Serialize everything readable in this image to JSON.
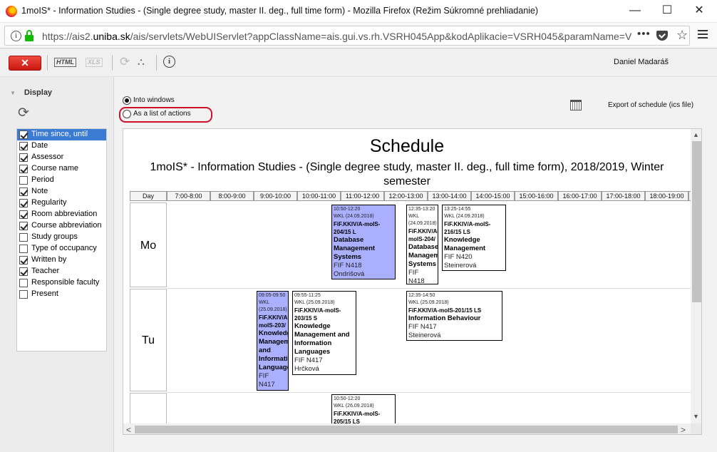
{
  "window": {
    "title": "1moIS* - Information Studies - (Single degree study, master II. deg., full time form) - Mozilla Firefox (Režim Súkromné prehliadanie)",
    "minimize": "—",
    "maximize": "☐",
    "close": "✕"
  },
  "urlbar": {
    "info": "i",
    "url_prefix": "https://ais2.",
    "url_domain": "uniba.sk",
    "url_rest": "/ais/servlets/WebUIServlet?appClassName=ais.gui.vs.rh.VSRH045App&kodAplikacie=VSRH045&paramName=VSRI",
    "more": "•••",
    "star": "☆"
  },
  "toolbar": {
    "close_label": "✕",
    "html_label": "HTML",
    "xls_label": "XLS",
    "refresh": "⟳",
    "tree": "⛬",
    "info": "i",
    "user": "Daniel Madaráš"
  },
  "left_panel": {
    "header": "Display",
    "tri": "▼",
    "refresh": "⟳",
    "items": [
      {
        "label": "Time since, until",
        "checked": true,
        "selected": true
      },
      {
        "label": "Date",
        "checked": true,
        "selected": false
      },
      {
        "label": "Assessor",
        "checked": true,
        "selected": false
      },
      {
        "label": "Course name",
        "checked": true,
        "selected": false
      },
      {
        "label": "Period",
        "checked": false,
        "selected": false
      },
      {
        "label": "Note",
        "checked": true,
        "selected": false
      },
      {
        "label": "Regularity",
        "checked": true,
        "selected": false
      },
      {
        "label": "Room abbreviation",
        "checked": true,
        "selected": false
      },
      {
        "label": "Course abbreviation",
        "checked": true,
        "selected": false
      },
      {
        "label": "Study groups",
        "checked": false,
        "selected": false
      },
      {
        "label": "Type of occupancy",
        "checked": false,
        "selected": false
      },
      {
        "label": "Written by",
        "checked": true,
        "selected": false
      },
      {
        "label": "Teacher",
        "checked": true,
        "selected": false
      },
      {
        "label": "Responsible faculty",
        "checked": false,
        "selected": false
      },
      {
        "label": "Present",
        "checked": false,
        "selected": false
      }
    ]
  },
  "view_options": {
    "into_windows": "Into windows",
    "as_list": "As a list of actions",
    "export": "Export of schedule (ics file)"
  },
  "schedule": {
    "title": "Schedule",
    "subtitle": "1moIS* - Information Studies - (Single degree study, master II. deg., full time form), 2018/2019, Winter semester",
    "day_header": "Day",
    "hours": [
      "7:00-8:00",
      "8:00-9:00",
      "9:00-10:00",
      "10:00-11:00",
      "11:00-12:00",
      "12:00-13:00",
      "13:00-14:00",
      "14:00-15:00",
      "15:00-16:00",
      "16:00-17:00",
      "17:00-18:00",
      "18:00-19:00",
      "19"
    ],
    "days": [
      "Mo",
      "Tu",
      ""
    ],
    "scroll_up": "▲",
    "scroll_down": "▼",
    "scroll_left": "<",
    "scroll_right": ">",
    "events": [
      {
        "time": "10:50-12:20",
        "week": "WKL (24.09.2018)",
        "code": "FiF.KKIV/A-moIS-204/15 L",
        "name": "Database Management Systems",
        "room": "FIF N418",
        "person": "Ondrišová",
        "color": "#aab0ff"
      },
      {
        "time": "12:35-13:20",
        "week": "WKL (24.09.2018)",
        "code": "FiF.KKIV/A-moIS-204/",
        "name": "Database Management Systems",
        "room": "FIF N418",
        "person": "Ondrišová",
        "color": "#ffffff"
      },
      {
        "time": "13:25-14:55",
        "week": "WKL (24.09.2018)",
        "code": "FiF.KKIV/A-moIS-216/15 LS",
        "name": "Knowledge Management",
        "room": "FIF N420",
        "person": "Steinerová",
        "color": "#ffffff"
      },
      {
        "time": "09:05-09:50",
        "week": "WKL (25.09.2018)",
        "code": "FiF.KKIV/A-moIS-203/",
        "name": "Knowledge Management and Information Languages",
        "room": "FIF N417",
        "person": "Hrčková",
        "color": "#aab0ff"
      },
      {
        "time": "09:55-11:25",
        "week": "WKL (25.09.2018)",
        "code": "FiF.KKIV/A-moIS-203/15 S",
        "name": "Knowledge Management and Information Languages",
        "room": "FIF N417",
        "person": "Hrčková",
        "color": "#ffffff"
      },
      {
        "time": "12:35-14:50",
        "week": "WKL (25.09.2018)",
        "code": "FiF.KKIV/A-moIS-201/15 LS",
        "name": "Information Behaviour",
        "room": "FIF N417",
        "person": "Steinerová",
        "color": "#ffffff"
      },
      {
        "time": "10:50-12:20",
        "week": "WKL (26.09.2018)",
        "code": "FiF.KKIV/A-moIS-205/15 LS",
        "name": "",
        "room": "",
        "person": "",
        "color": "#ffffff"
      }
    ]
  }
}
